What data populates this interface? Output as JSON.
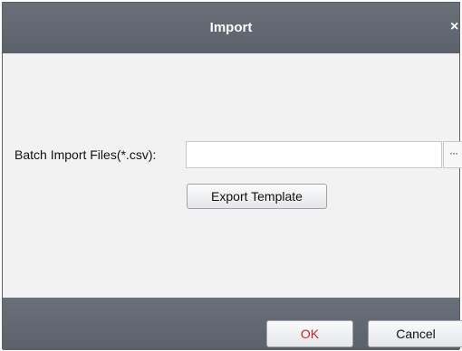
{
  "dialog": {
    "title": "Import",
    "close_glyph": "×"
  },
  "form": {
    "batch_import_label": "Batch Import Files(*.csv):",
    "file_value": "",
    "browse_label": "···",
    "export_template_label": "Export Template"
  },
  "footer": {
    "ok_label": "OK",
    "cancel_label": "Cancel"
  },
  "colors": {
    "titlebar": "#5f656e",
    "body": "#f2f2f2",
    "ok_text": "#c0282c"
  }
}
